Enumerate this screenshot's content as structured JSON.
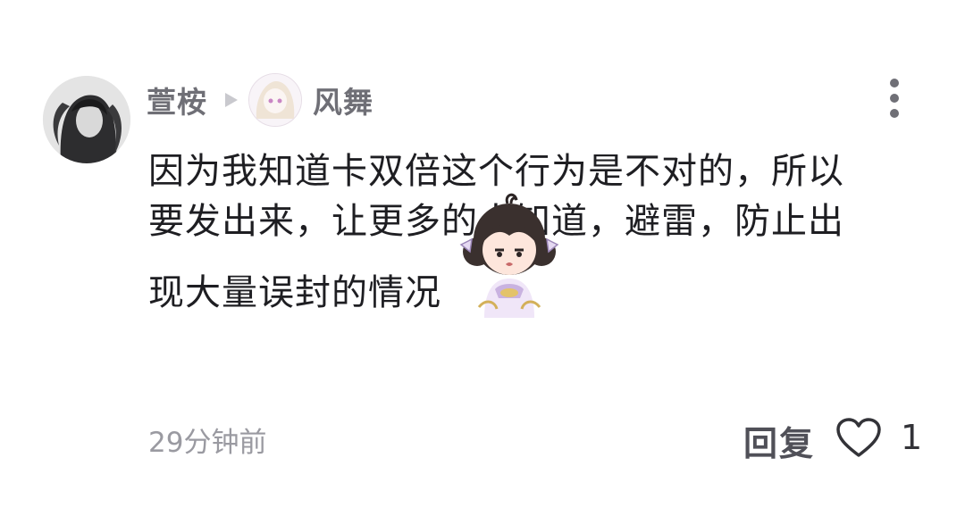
{
  "comment": {
    "username": "萱桉",
    "reply_to": "风舞",
    "lines": [
      "因为我知道卡双倍这个行为是不对的，所以",
      "要发出来，让更多的人知道，避雷，防止出",
      "现大量误封的情况"
    ],
    "time": "29分钟前",
    "reply_label": "回复",
    "like_count": "1",
    "small_avatar_text": "风舞"
  },
  "icons": {
    "more": "more-vertical-icon",
    "reply_indicator": "play-arrow-icon",
    "like": "heart-outline-icon",
    "sticker": "cartoon-girl-sticker"
  },
  "colors": {
    "name": "#6f6f76",
    "text": "#1e1e22",
    "meta": "#9a9aa1"
  }
}
